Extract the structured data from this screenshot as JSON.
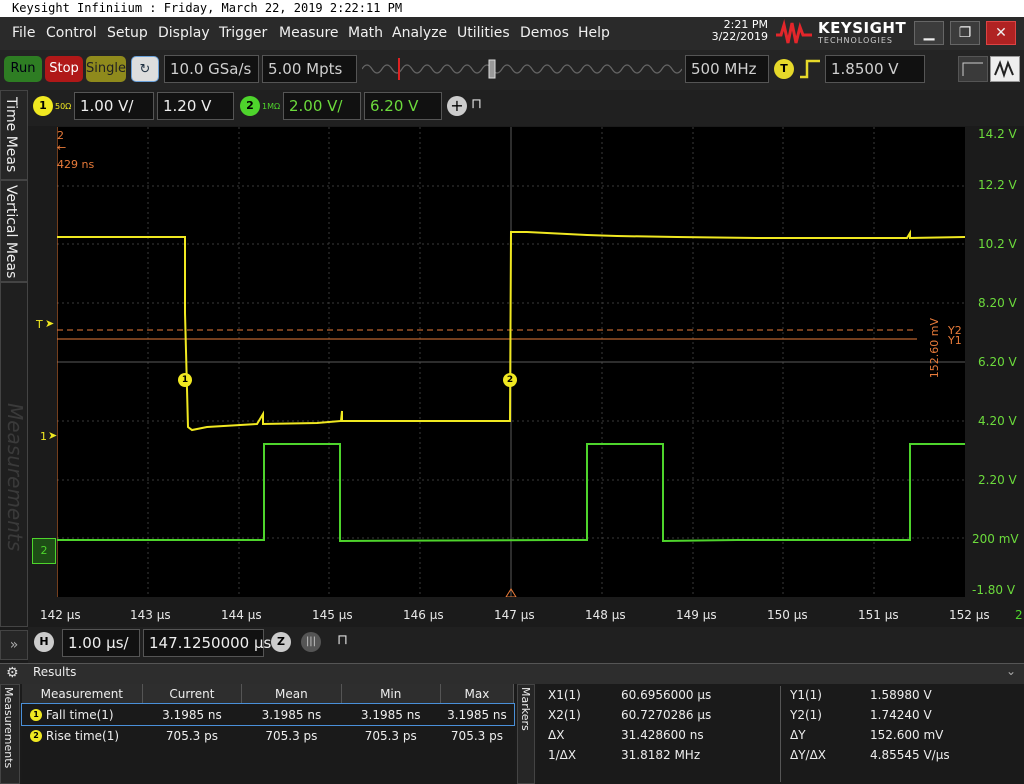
{
  "window": {
    "title": "Keysight Infiniium : Friday, March 22, 2019 2:22:11 PM"
  },
  "menu": [
    "File",
    "Control",
    "Setup",
    "Display",
    "Trigger",
    "Measure",
    "Math",
    "Analyze",
    "Utilities",
    "Demos",
    "Help"
  ],
  "clock": {
    "time": "2:21 PM",
    "date": "3/22/2019"
  },
  "brand": {
    "name": "KEYSIGHT",
    "sub": "TECHNOLOGIES"
  },
  "toolbar": {
    "run": "Run",
    "stop": "Stop",
    "single": "Single",
    "sample_rate": "10.0 GSa/s",
    "memory_depth": "5.00 Mpts",
    "bandwidth": "500 MHz",
    "trigger_badge": "T",
    "trigger_level": "1.8500 V"
  },
  "channels": [
    {
      "num": "1",
      "impedance": "50Ω",
      "scale": "1.00 V/",
      "offset": "1.20 V",
      "color": "#f0e821"
    },
    {
      "num": "2",
      "impedance": "1MΩ",
      "scale": "2.00 V/",
      "offset": "6.20 V",
      "color": "#4ed42c"
    }
  ],
  "side_tabs": [
    "Time Meas",
    "Vertical Meas",
    "Measurements"
  ],
  "grid": {
    "right_labels": [
      "14.2 V",
      "12.2 V",
      "10.2 V",
      "8.20 V",
      "6.20 V",
      "4.20 V",
      "2.20 V",
      "200 mV",
      "-1.80 V"
    ],
    "x_labels": [
      "142 µs",
      "143 µs",
      "144 µs",
      "145 µs",
      "146 µs",
      "147 µs",
      "148 µs",
      "149 µs",
      "150 µs",
      "151 µs",
      "152 µs"
    ],
    "marker_delta_text": "429 ns",
    "marker_num": "2",
    "cursor_dy_text": "152.60 mV",
    "y2_label": "Y2",
    "y1_label": "Y1",
    "trigger_mark": "T",
    "ch1_marker": "1",
    "ch2_marker": "2",
    "right_edge_label": "2",
    "watermark": "Measurements"
  },
  "horizontal": {
    "badge": "H",
    "scale": "1.00 µs/",
    "position": "147.1250000 µs"
  },
  "results": {
    "title": "Results",
    "headers": [
      "Measurement",
      "Current",
      "Mean",
      "Min",
      "Max"
    ],
    "rows": [
      {
        "badge": "1",
        "name": "Fall time(1)",
        "current": "3.1985 ns",
        "mean": "3.1985 ns",
        "min": "3.1985 ns",
        "max": "3.1985 ns"
      },
      {
        "badge": "2",
        "name": "Rise time(1)",
        "current": "705.3 ps",
        "mean": "705.3 ps",
        "min": "705.3 ps",
        "max": "705.3 ps"
      }
    ],
    "markers_tab": "Markers",
    "markers_left": [
      {
        "label": "X1(1)",
        "value": "60.6956000 µs"
      },
      {
        "label": "X2(1)",
        "value": "60.7270286 µs"
      },
      {
        "label": "ΔX",
        "value": "31.428600 ns"
      },
      {
        "label": "1/ΔX",
        "value": "31.8182 MHz"
      }
    ],
    "markers_right": [
      {
        "label": "Y1(1)",
        "value": "1.58980 V"
      },
      {
        "label": "Y2(1)",
        "value": "1.74240 V"
      },
      {
        "label": "ΔY",
        "value": "152.600 mV"
      },
      {
        "label": "ΔY/ΔX",
        "value": "4.85545 V/µs"
      }
    ]
  }
}
